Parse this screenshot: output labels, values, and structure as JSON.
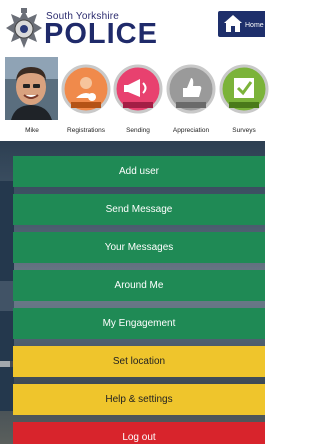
{
  "header": {
    "org_top": "South Yorkshire",
    "org_main": "POLICE",
    "home_label": "Home"
  },
  "profile": {
    "name": "Mike",
    "badges": [
      {
        "label": "Registrations",
        "icon": "registrations-icon",
        "color": "#f08a4b"
      },
      {
        "label": "Sending",
        "icon": "megaphone-icon",
        "color": "#e8416f"
      },
      {
        "label": "Appreciation",
        "icon": "thumbs-up-icon",
        "color": "#9a9a9a"
      },
      {
        "label": "Surveys",
        "icon": "survey-check-icon",
        "color": "#7bb33a"
      }
    ]
  },
  "menu": {
    "items": [
      {
        "label": "Add user",
        "color": "#1f8a55"
      },
      {
        "label": "Send Message",
        "color": "#1f8a55"
      },
      {
        "label": "Your Messages",
        "color": "#1f8a55"
      },
      {
        "label": "Around Me",
        "color": "#1f8a55"
      },
      {
        "label": "My Engagement",
        "color": "#1f8a55"
      },
      {
        "label": "Set location",
        "color": "#efc52c"
      },
      {
        "label": "Help & settings",
        "color": "#efc52c"
      },
      {
        "label": "Log out",
        "color": "#d8242c"
      }
    ]
  }
}
